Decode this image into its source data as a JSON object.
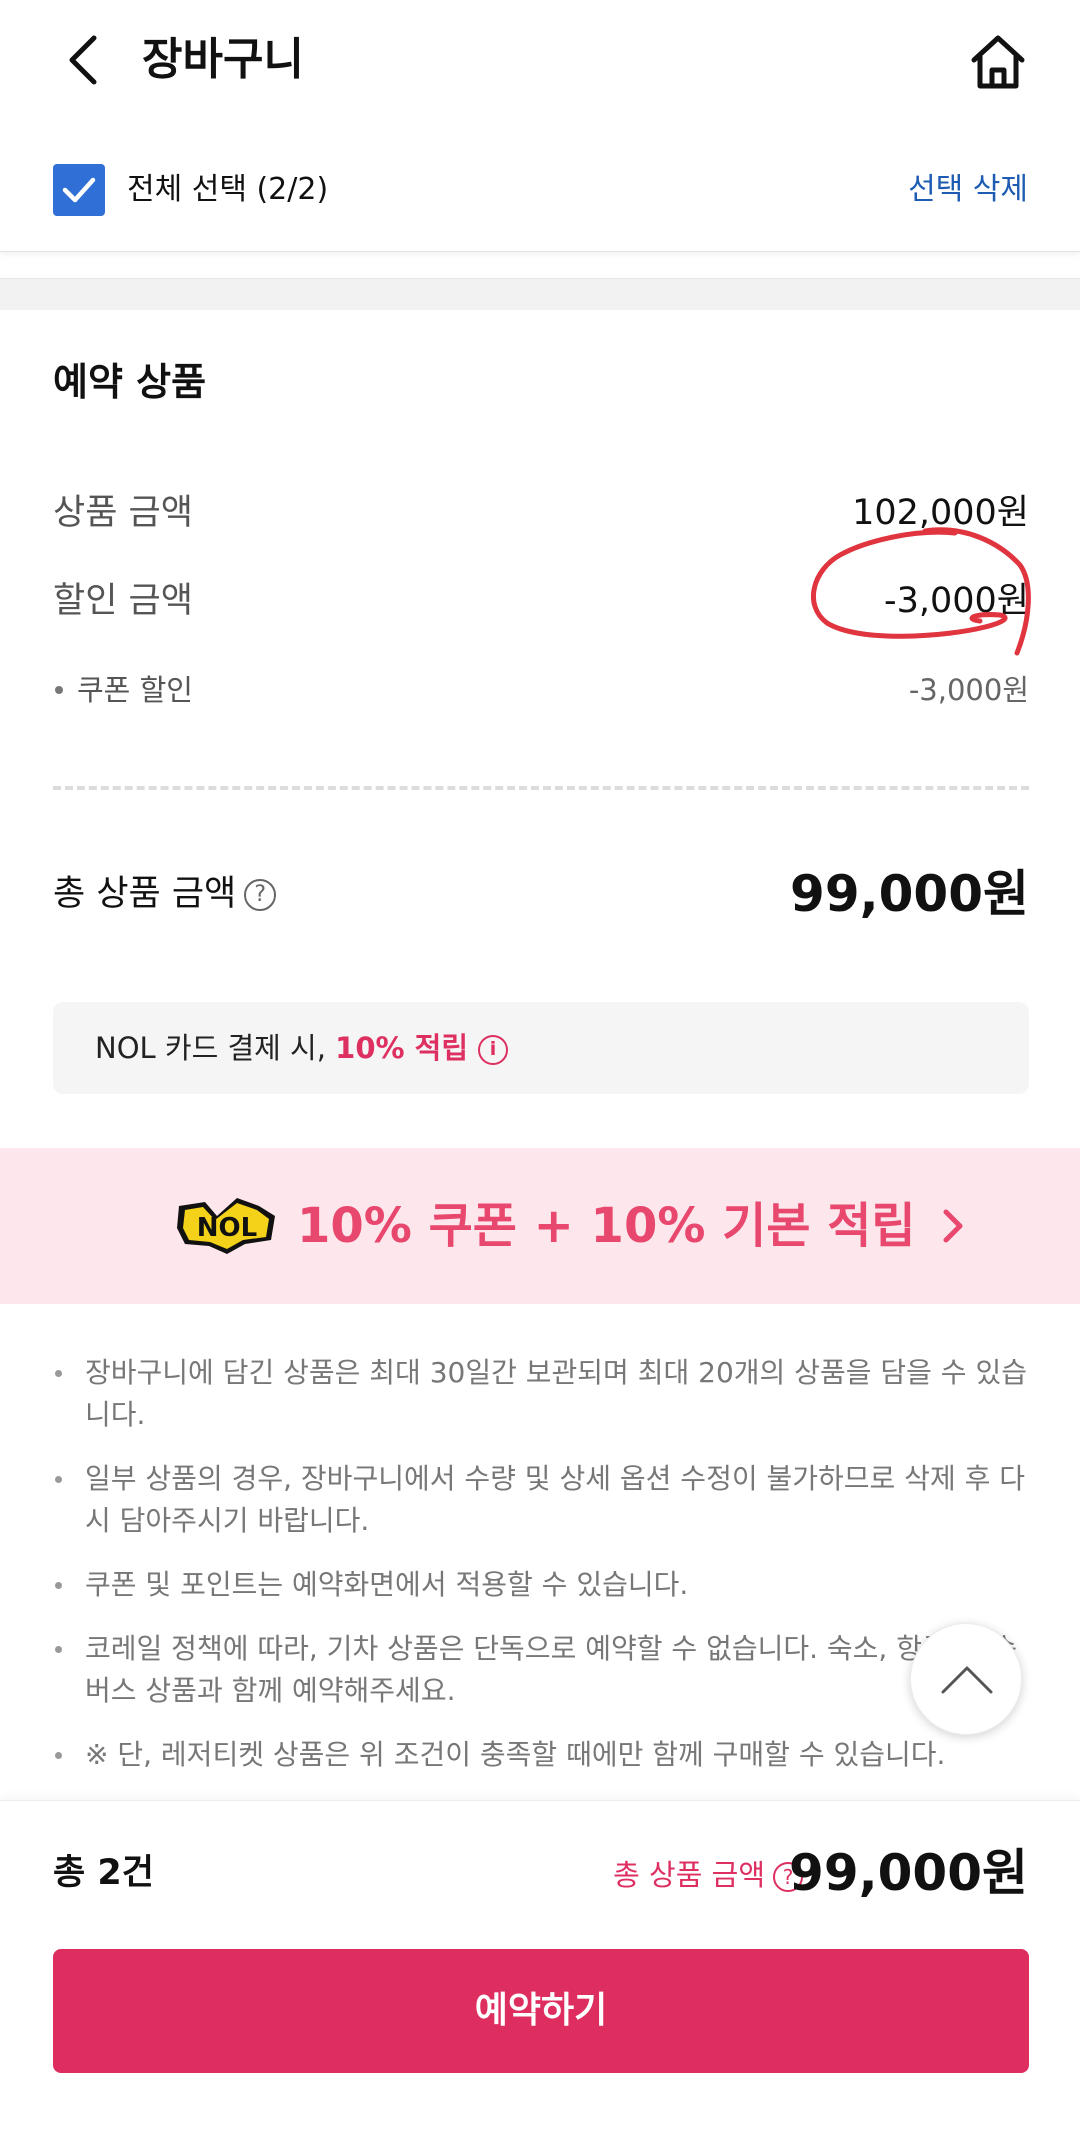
{
  "header": {
    "title": "장바구니",
    "back_icon": "chevron-left-icon",
    "home_icon": "home-icon"
  },
  "select_bar": {
    "select_all_label": "전체 선택 (2/2)",
    "checked": true,
    "delete_label": "선택 삭제"
  },
  "summary": {
    "section_title": "예약 상품",
    "product_amount_label": "상품 금액",
    "product_amount": "102,000원",
    "discount_label": "할인 금액",
    "discount_amount": "-3,000원",
    "coupon_label": "쿠폰 할인",
    "coupon_amount": "-3,000원",
    "total_label": "총 상품 금액",
    "total_amount": "99,000원",
    "help_glyph": "?"
  },
  "nol_card": {
    "text": "NOL 카드 결제 시, ",
    "highlight": "10% 적립",
    "info_glyph": "i"
  },
  "banner": {
    "logo_text": "NOL",
    "text": "10% 쿠폰 + 10% 기본 적립"
  },
  "notes": [
    "장바구니에 담긴 상품은 최대 30일간 보관되며 최대 20개의 상품을 담을 수 있습니다.",
    "일부 상품의 경우, 장바구니에서 수량 및 상세 옵션 수정이 불가하므로 삭제 후 다시 담아주시기 바랍니다.",
    "쿠폰 및 포인트는 예약화면에서 적용할 수 있습니다.",
    "코레일 정책에 따라, 기차 상품은 단독으로 예약할 수 없습니다. 숙소, 항공, 고속버스 상품과 함께 예약해주세요.",
    "※ 단, 레저티켓 상품은 위 조건이 충족할 때에만 함께 구매할 수 있습니다."
  ],
  "footer": {
    "count_label": "총 2건",
    "total_label": "총 상품 금액",
    "total_amount": "99,000원",
    "reserve_button": "예약하기"
  },
  "colors": {
    "accent": "#de2d5f",
    "link": "#1e5cb3",
    "checkbox": "#2f6fd6",
    "banner_bg": "#fde7ec",
    "annotation": "#e0343e"
  }
}
